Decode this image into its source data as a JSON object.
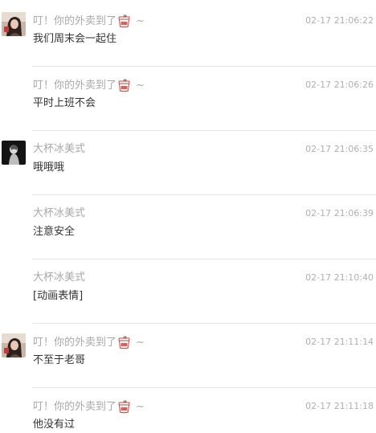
{
  "messages": [
    {
      "sender": "叮！你的外卖到了",
      "has_bowl_icon": true,
      "tilde": "~",
      "time": "02-17 21:06:22",
      "text": "我们周末会一起住",
      "avatar": "girl"
    },
    {
      "sender": "叮！你的外卖到了",
      "has_bowl_icon": true,
      "tilde": "~",
      "time": "02-17 21:06:26",
      "text": "平时上班不会",
      "avatar": ""
    },
    {
      "sender": "大杯冰美式",
      "has_bowl_icon": false,
      "tilde": "",
      "time": "02-17 21:06:35",
      "text": "哦哦哦",
      "avatar": "dark"
    },
    {
      "sender": "大杯冰美式",
      "has_bowl_icon": false,
      "tilde": "",
      "time": "02-17 21:06:39",
      "text": "注意安全",
      "avatar": ""
    },
    {
      "sender": "大杯冰美式",
      "has_bowl_icon": false,
      "tilde": "",
      "time": "02-17 21:10:40",
      "text": "[动画表情]",
      "avatar": ""
    },
    {
      "sender": "叮！你的外卖到了",
      "has_bowl_icon": true,
      "tilde": "~",
      "time": "02-17 21:11:14",
      "text": "不至于老哥",
      "avatar": "girl"
    },
    {
      "sender": "叮！你的外卖到了",
      "has_bowl_icon": true,
      "tilde": "~",
      "time": "02-17 21:11:18",
      "text": "他没有过",
      "avatar": ""
    }
  ],
  "colors": {
    "sender_text": "#a8a8a8",
    "time_text": "#b0b0b0",
    "message_text": "#333333",
    "divider": "#e5e5e5"
  },
  "icons": {
    "bowl": "bowl-icon",
    "avatar_girl": "avatar-girl-icon",
    "avatar_dark": "avatar-dark-icon"
  }
}
